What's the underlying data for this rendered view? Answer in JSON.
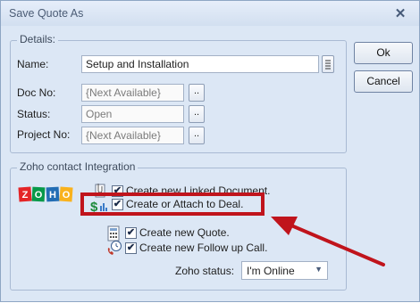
{
  "window": {
    "title": "Save Quote As",
    "close_glyph": "✕"
  },
  "details": {
    "caption": "Details:",
    "name_label": "Name:",
    "name_value": "Setup and Installation",
    "docno_label": "Doc No:",
    "docno_value": "{Next Available}",
    "status_label": "Status:",
    "status_value": "Open",
    "project_label": "Project No:",
    "project_value": "{Next Available}",
    "browse_label": ".."
  },
  "buttons": {
    "ok": "Ok",
    "cancel": "Cancel"
  },
  "zoho": {
    "caption": "Zoho contact Integration",
    "logo_text": "ZOHO",
    "options": {
      "linked": "Create new Linked Document.",
      "deal": "Create or Attach to Deal.",
      "quote": "Create new Quote.",
      "followup": "Create new Follow up Call."
    },
    "checked": {
      "linked": true,
      "deal": true,
      "quote": true,
      "followup": true
    },
    "check_glyph": "✔",
    "status_label": "Zoho status:",
    "status_value": "I'm Online"
  },
  "colors": {
    "highlight_box": "#c0141c",
    "arrow": "#c0141c",
    "accent": "#2e73c8"
  },
  "icons": {
    "deal": "dollar-sign-icon",
    "linked": "paperclip-document-icon",
    "quote": "calculator-document-icon",
    "followup": "phone-clock-icon",
    "ellipsis": "ellipsis-icon",
    "dropdown": "chevron-down-icon",
    "close": "close-icon",
    "zoho": "zoho-logo"
  }
}
